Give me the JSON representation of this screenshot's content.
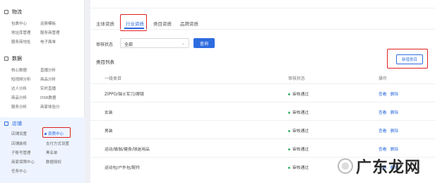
{
  "sidebar": {
    "logistics": {
      "title": "物流",
      "items": [
        "包裹中心",
        "运费模板",
        "地址库管理",
        "服务商管理",
        "服务商地址",
        "电子面单"
      ]
    },
    "data": {
      "title": "数据",
      "items": [
        "核心数据",
        "直播分析",
        "短视频分析",
        "商品分析",
        "达人分析",
        "实时直播",
        "商品分析",
        "DSR数据",
        "服务分析",
        "商家体验分"
      ]
    },
    "store": {
      "title": "店铺",
      "items": [
        "店铺设置",
        "资质中心",
        "店铺装修",
        "支付方式设置",
        "子账号管理",
        "黑名单",
        "商家保障中心",
        "数据授权",
        "任务中心"
      ]
    }
  },
  "tabs": [
    "主体资质",
    "行业资质",
    "类目资质",
    "品牌资质"
  ],
  "filter": {
    "label": "审核状态",
    "value": "全部",
    "query_btn": "查询"
  },
  "list": {
    "title": "类目列表",
    "new_btn": "新增类目",
    "columns": [
      "一级类目",
      "审核状态",
      "操作"
    ],
    "rows": [
      {
        "category": "ZIPPO/瑞士军刀/眼镜",
        "status": "审核通过",
        "view": "查看",
        "delete": "删除"
      },
      {
        "category": "女装",
        "status": "审核通过",
        "view": "查看",
        "delete": "删除"
      },
      {
        "category": "男装",
        "status": "审核通过",
        "view": "查看",
        "delete": "删除"
      },
      {
        "category": "运动/瑜伽/健身/球迷用品",
        "status": "审核通过",
        "view": "查看",
        "delete": "删除"
      },
      {
        "category": "运动包/户外包/配件",
        "status": "审核通过",
        "view": "查看",
        "delete": "删除"
      }
    ]
  },
  "watermark": "广东龙网",
  "colors": {
    "primary": "#2d6cdf",
    "highlight": "#e02020",
    "success": "#3ab66a"
  }
}
